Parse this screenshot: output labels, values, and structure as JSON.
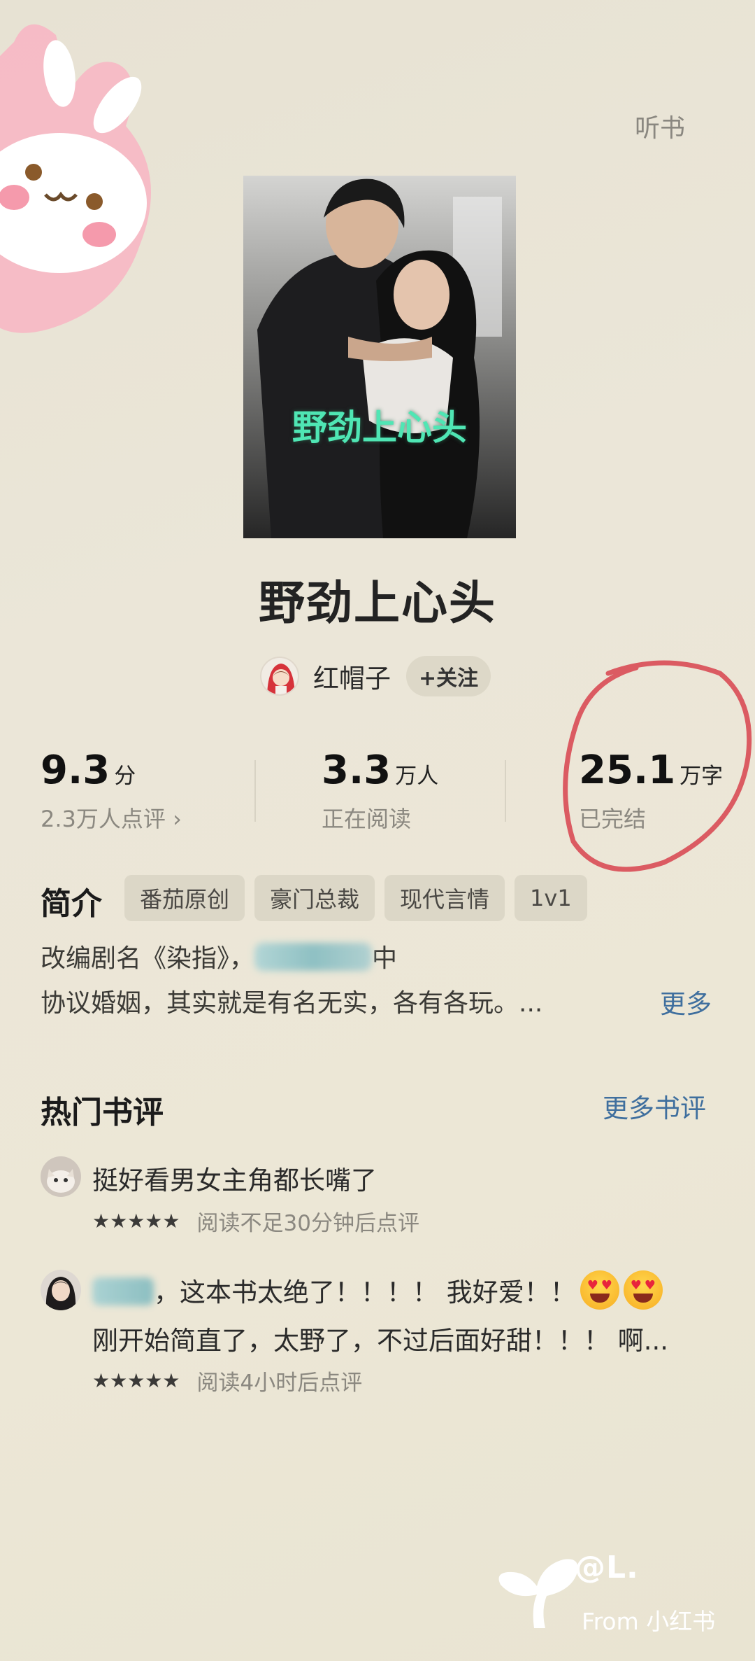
{
  "header": {
    "listen_label": "听书"
  },
  "book": {
    "cover_title": "野劲上心头",
    "title": "野劲上心头",
    "author": "红帽子",
    "follow_label": "+关注"
  },
  "stats": [
    {
      "value": "9.3",
      "unit": "分",
      "sub": "2.3万人点评 ›"
    },
    {
      "value": "3.3",
      "unit": "万人",
      "sub": "正在阅读"
    },
    {
      "value": "25.1",
      "unit": "万字",
      "sub": "已完结"
    }
  ],
  "intro": {
    "heading": "简介",
    "tags": [
      "番茄原创",
      "豪门总裁",
      "现代言情",
      "1v1"
    ],
    "line1_prefix": "改编剧名《染指》，",
    "line1_suffix": "中",
    "line2": "协议婚姻，其实就是有名无实，各有各玩。...",
    "more_label": "更多"
  },
  "reviews_section": {
    "heading": "热门书评",
    "more_label": "更多书评",
    "reviews": [
      {
        "text": "挺好看男女主角都长嘴了",
        "rating": 5,
        "meta": "阅读不足30分钟后点评"
      },
      {
        "text_after_name": "，这本书太绝了！！！！ 我好爱！！",
        "line2": "刚开始简直了，太野了，不过后面好甜！！！ 啊...",
        "rating": 5,
        "meta": "阅读4小时后点评"
      }
    ]
  },
  "watermark": {
    "handle": "@L.",
    "from": "From 小红书"
  },
  "colors": {
    "background": "#ebe6d8",
    "link": "#3f6f9e",
    "annotation_circle": "#d8424e",
    "cover_title": "#4fe6b4"
  }
}
